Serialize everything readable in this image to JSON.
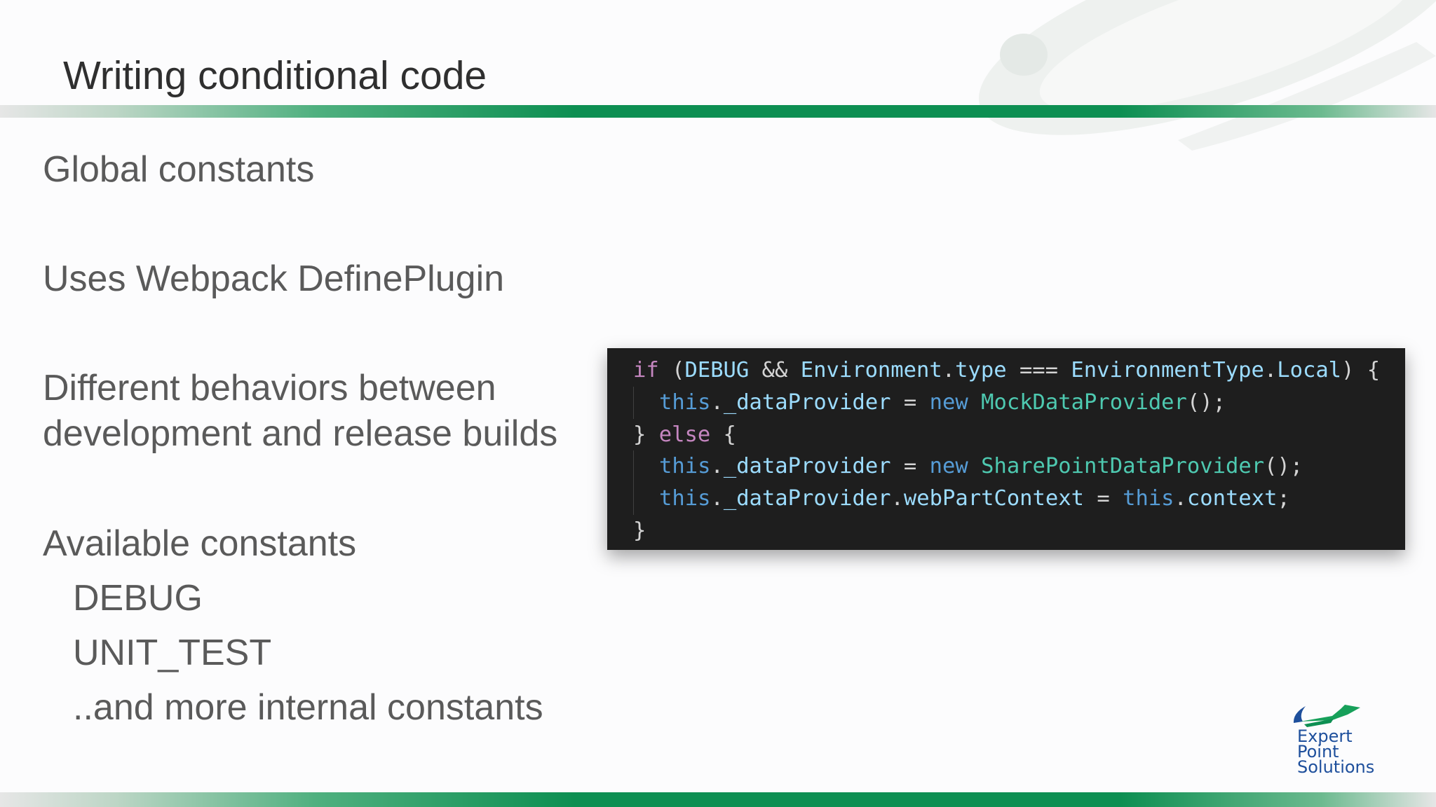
{
  "slide": {
    "title": "Writing conditional code",
    "bullets": {
      "global_constants": "Global constants",
      "uses_webpack": "Uses Webpack DefinePlugin",
      "different_behaviors_line1": "Different behaviors between",
      "different_behaviors_line2": "development and release builds",
      "available_constants": "Available constants",
      "debug": "DEBUG",
      "unit_test": "UNIT_TEST",
      "and_more": "..and more internal constants"
    }
  },
  "code": {
    "line1": {
      "if": "if",
      "open": " (",
      "debug": "DEBUG",
      "and": " && ",
      "environment": "Environment",
      "dot1": ".",
      "type": "type",
      "eq": " === ",
      "env_type": "EnvironmentType",
      "dot2": ".",
      "local": "Local",
      "close": ") {"
    },
    "line2": {
      "this": "this",
      "dot": ".",
      "provider": "_dataProvider",
      "assign": " = ",
      "new": "new",
      "space": " ",
      "cls": "MockDataProvider",
      "end": "();"
    },
    "line3": {
      "brace": "} ",
      "else": "else",
      "open": " {"
    },
    "line4": {
      "this": "this",
      "dot": ".",
      "provider": "_dataProvider",
      "assign": " = ",
      "new": "new",
      "space": " ",
      "cls": "SharePointDataProvider",
      "end": "();"
    },
    "line5": {
      "this": "this",
      "dot1": ".",
      "provider": "_dataProvider",
      "dot2": ".",
      "web_part_context": "webPartContext",
      "assign": " = ",
      "this2": "this",
      "dot3": ".",
      "context": "context",
      "end": ";"
    },
    "line6": {
      "brace": "}"
    }
  },
  "logo": {
    "line1": "Expert",
    "line2": "Point",
    "line3": "Solutions"
  },
  "colors": {
    "accent_green": "#0d8f52",
    "code_background": "#1e1e1e",
    "logo_blue": "#1e4f9c"
  }
}
